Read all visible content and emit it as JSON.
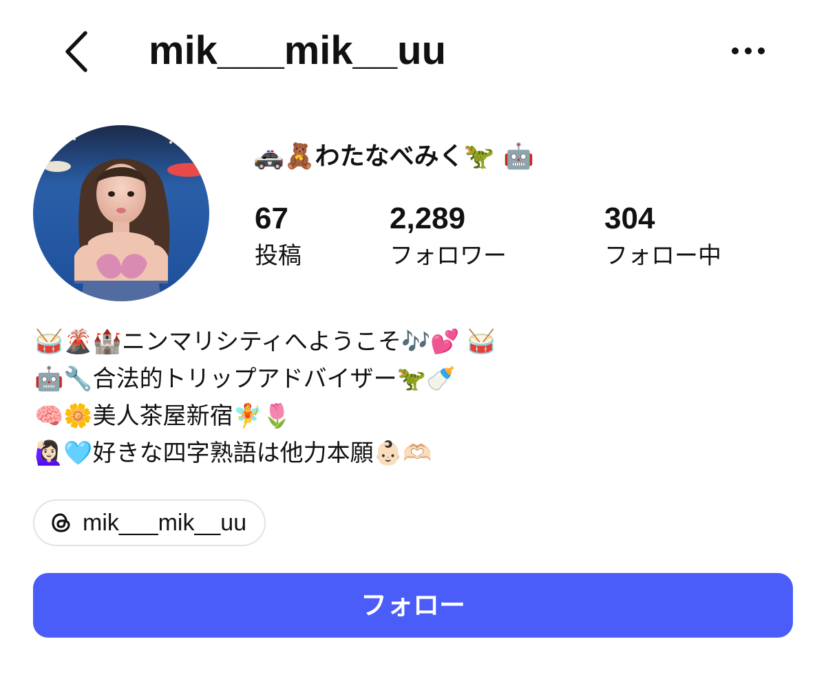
{
  "header": {
    "username": "mik___mik__uu",
    "back_icon": "chevron-left-icon",
    "more_icon": "more-horizontal-icon"
  },
  "profile": {
    "display_name": "🚓🧸わたなべみく🦖 🤖",
    "avatar_icon": "profile-photo"
  },
  "stats": {
    "posts": {
      "value": "67",
      "label": "投稿"
    },
    "followers": {
      "value": "2,289",
      "label": "フォロワー"
    },
    "following": {
      "value": "304",
      "label": "フォロー中"
    }
  },
  "bio": {
    "lines": [
      "🥁🌋🏰ニンマリシティへようこそ🎶💕 🥁",
      "🤖🔧合法的トリップアドバイザー🦖🍼",
      "🧠🌼美人茶屋新宿🧚🌷",
      "🙋🏻‍♀️🩵好きな四字熟語は他力本願👶🏻🫶🏻"
    ]
  },
  "threads_link": {
    "label": "mik___mik__uu",
    "icon": "threads-icon"
  },
  "follow_button": {
    "label": "フォロー",
    "color": "#4a5df9"
  }
}
